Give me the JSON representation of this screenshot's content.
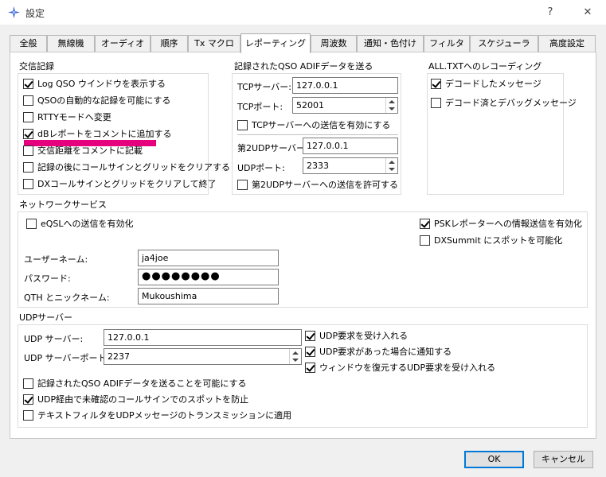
{
  "window": {
    "title": "設定",
    "help": "?",
    "close": "✕"
  },
  "tabs": [
    "全般",
    "無線機",
    "オーディオ",
    "順序",
    "Tx マクロ",
    "レポーティング",
    "周波数",
    "通知・色付け",
    "フィルタ",
    "スケジューラ",
    "高度設定"
  ],
  "active_tab": "レポーティング",
  "log_group": {
    "title": "交信記録",
    "items": [
      {
        "label": "Log QSO ウインドウを表示する",
        "checked": true
      },
      {
        "label": "QSOの自動的な記録を可能にする",
        "checked": false
      },
      {
        "label": "RTTYモードへ変更",
        "checked": false
      },
      {
        "label": "dBレポートをコメントに追加する",
        "checked": true
      },
      {
        "label": "交信距離をコメントに記載",
        "checked": false
      },
      {
        "label": "記録の後にコールサインとグリッドをクリアする",
        "checked": false
      },
      {
        "label": "DXコールサインとグリッドをクリアして終了",
        "checked": false
      }
    ]
  },
  "adif_group": {
    "title": "記録されたQSO ADIFデータを送る",
    "tcp_server_label": "TCPサーバー:",
    "tcp_server_value": "127.0.0.1",
    "tcp_port_label": "TCPポート:",
    "tcp_port_value": "52001",
    "tcp_enable_label": "TCPサーバーへの送信を有効にする",
    "udp2_server_label": "第2UDPサーバー",
    "udp2_server_value": "127.0.0.1",
    "udp_port_label": "UDPポート:",
    "udp_port_value": "2333",
    "udp2_allow_label": "第2UDPサーバーへの送信を許可する"
  },
  "alltxt_group": {
    "title": "ALL.TXTへのレコーディング",
    "items": [
      {
        "label": "デコードしたメッセージ",
        "checked": true
      },
      {
        "label": "デコード済とデバッグメッセージ",
        "checked": false
      }
    ]
  },
  "network_group": {
    "title": "ネットワークサービス",
    "eqsl_label": "eQSLへの送信を有効化",
    "psk_label": "PSKレポーターへの情報送信を有効化",
    "dxsummit_label": "DXSummit にスポットを可能化",
    "username_label": "ユーザーネーム:",
    "username_value": "ja4joe",
    "password_label": "パスワード:",
    "password_value": "●●●●●●●●",
    "qth_label": "QTH とニックネーム:",
    "qth_value": "Mukoushima"
  },
  "udp_group": {
    "title": "UDPサーバー",
    "server_label": "UDP サーバー:",
    "server_value": "127.0.0.1",
    "port_label": "UDP サーバーポート:",
    "port_value": "2237",
    "accept_label": "UDP要求を受け入れる",
    "notify_label": "UDP要求があった場合に通知する",
    "restore_label": "ウィンドウを復元するUDP要求を受け入れる",
    "send_adif_label": "記録されたQSO ADIFデータを送ることを可能にする",
    "prevent_spot_label": "UDP経由で未確認のコールサインでのスポットを防止",
    "text_filter_label": "テキストフィルタをUDPメッセージのトランスミッションに適用"
  },
  "buttons": {
    "ok": "OK",
    "cancel": "キャンセル"
  },
  "colors": {
    "highlight": "#e6007e",
    "focus": "#0078d7"
  }
}
